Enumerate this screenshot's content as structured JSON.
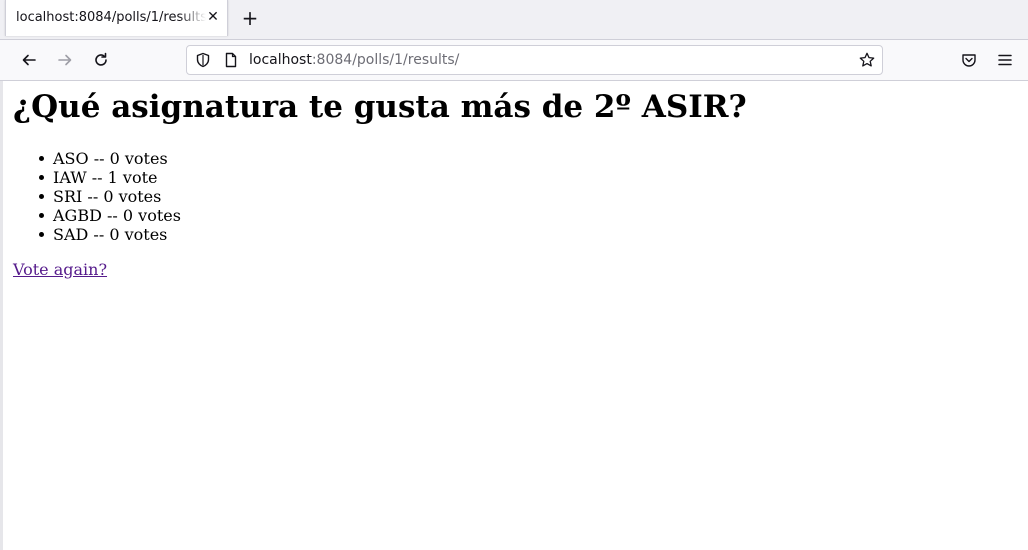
{
  "browser": {
    "tab": {
      "title": "localhost:8084/polls/1/results/"
    },
    "url": {
      "host": "localhost",
      "rest": ":8084/polls/1/results/"
    }
  },
  "page": {
    "title": "¿Qué asignatura te gusta más de 2º ASIR?",
    "results": [
      "ASO -- 0 votes",
      "IAW -- 1 vote",
      "SRI -- 0 votes",
      "AGBD -- 0 votes",
      "SAD -- 0 votes"
    ],
    "vote_again_link": "Vote again?"
  },
  "colors": {
    "visited_link": "#551a8b",
    "chrome_bg": "#f0f0f4",
    "toolbar_bg": "#f9f9fb"
  }
}
